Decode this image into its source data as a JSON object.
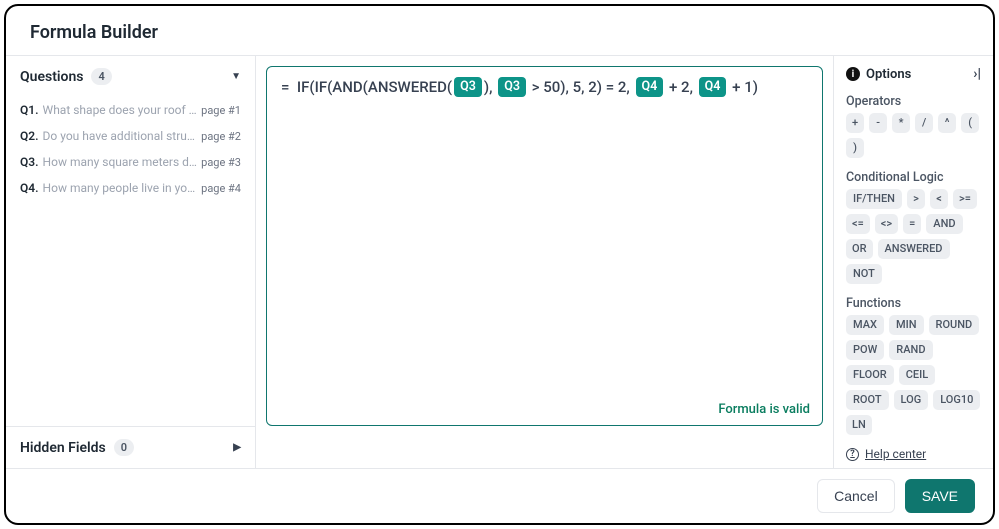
{
  "title": "Formula Builder",
  "questions": {
    "header": "Questions",
    "count": "4",
    "items": [
      {
        "id": "Q1.",
        "text": "What shape does your roof have?",
        "page": "page #1"
      },
      {
        "id": "Q2.",
        "text": "Do you have additional structures …",
        "page": "page #2"
      },
      {
        "id": "Q3.",
        "text": "How many square meters does yo…",
        "page": "page #3"
      },
      {
        "id": "Q4.",
        "text": "How many people live in your hou…",
        "page": "page #4"
      }
    ]
  },
  "hidden": {
    "header": "Hidden Fields",
    "count": "0"
  },
  "formula": {
    "tokens": [
      {
        "t": "text",
        "v": "=  IF(IF(AND(ANSWERED("
      },
      {
        "t": "q",
        "v": "Q3"
      },
      {
        "t": "text",
        "v": "), "
      },
      {
        "t": "q",
        "v": "Q3"
      },
      {
        "t": "text",
        "v": " > 50), 5, 2) = 2, "
      },
      {
        "t": "q",
        "v": "Q4"
      },
      {
        "t": "text",
        "v": " + 2, "
      },
      {
        "t": "q",
        "v": "Q4"
      },
      {
        "t": "text",
        "v": " + 1)"
      }
    ],
    "status": "Formula is valid"
  },
  "options": {
    "header": "Options",
    "operators": {
      "label": "Operators",
      "items": [
        "+",
        "-",
        "*",
        "/",
        "^",
        "(",
        ")"
      ]
    },
    "conditional": {
      "label": "Conditional Logic",
      "items": [
        "IF/THEN",
        ">",
        "<",
        ">=",
        "<=",
        "<>",
        "=",
        "AND",
        "OR",
        "ANSWERED",
        "NOT"
      ]
    },
    "functions": {
      "label": "Functions",
      "items": [
        "MAX",
        "MIN",
        "ROUND",
        "POW",
        "RAND",
        "FLOOR",
        "CEIL",
        "ROOT",
        "LOG",
        "LOG10",
        "LN"
      ]
    }
  },
  "help": "Help center",
  "footer": {
    "cancel": "Cancel",
    "save": "SAVE"
  }
}
